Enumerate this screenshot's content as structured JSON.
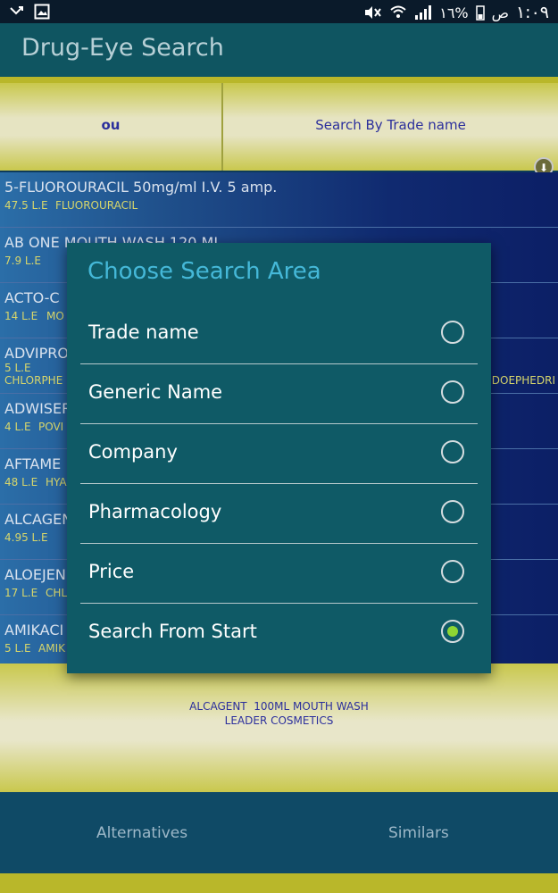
{
  "status_bar": {
    "time": "١:٠٩",
    "ampm": "ص",
    "battery": "١٦%"
  },
  "app": {
    "title": "Drug-Eye Search"
  },
  "search": {
    "query": "ou",
    "mode_label": "Search By Trade name"
  },
  "list": [
    {
      "name": "5-FLUOROURACIL 50mg/ml I.V. 5 amp.",
      "price": "47.5 L.E",
      "generic": "FLUOROURACIL"
    },
    {
      "name": "AB ONE MOUTH WASH 120 ML",
      "price": "7.9 L.E",
      "generic": ""
    },
    {
      "name": "ACTO-C",
      "price": "14 L.E",
      "generic": "MO"
    },
    {
      "name": "ADVIPRO",
      "price": "5 L.E",
      "generic": "CHLORPHE",
      "extra": "DOEPHEDRI"
    },
    {
      "name": "ADWISER",
      "price": "4 L.E",
      "generic": "POVI"
    },
    {
      "name": "AFTAME",
      "price": "48 L.E",
      "generic": "HYA"
    },
    {
      "name": "ALCAGEN",
      "price": "4.95 L.E",
      "generic": ""
    },
    {
      "name": "ALOEJEN",
      "price": "17 L.E",
      "generic": "CHL"
    },
    {
      "name": "AMIKACI",
      "price": "5 L.E",
      "generic": "AMIK"
    }
  ],
  "dialog": {
    "title": "Choose Search Area",
    "options": [
      {
        "label": "Trade name",
        "checked": false
      },
      {
        "label": "Generic Name",
        "checked": false
      },
      {
        "label": "Company",
        "checked": false
      },
      {
        "label": "Pharmacology",
        "checked": false
      },
      {
        "label": "Price",
        "checked": false
      },
      {
        "label": "Search From Start",
        "checked": true
      }
    ]
  },
  "detail": {
    "line1": "ALCAGENT  100ML MOUTH WASH",
    "line2": "LEADER COSMETICS"
  },
  "bottom": {
    "alternatives": "Alternatives",
    "similars": "Similars"
  },
  "colors": {
    "accent_yellow": "#b9b72a",
    "dialog_bg": "#0f5a66",
    "radio_checked": "#8dd633",
    "title_cyan": "#45b8d8"
  }
}
